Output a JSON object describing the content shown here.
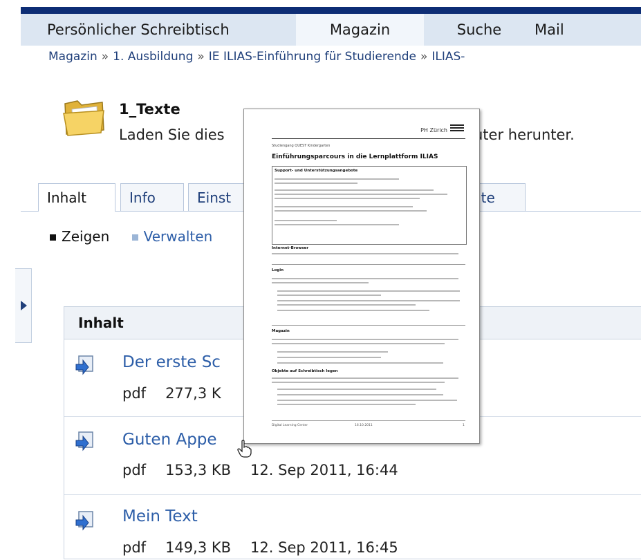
{
  "menu": {
    "items": [
      "Persönlicher Schreibtisch",
      "Magazin",
      "Suche",
      "Mail"
    ],
    "active_index": 1
  },
  "breadcrumb": {
    "items": [
      "Magazin",
      "1. Ausbildung",
      "IE ILIAS-Einführung für Studierende",
      "ILIAS-"
    ],
    "separator": "»"
  },
  "header": {
    "icon": "folder-icon",
    "title": "1_Texte",
    "description_left": "Laden Sie dies",
    "description_right": "uter herunter."
  },
  "tabs": {
    "items": [
      "Inhalt",
      "Info",
      "Einst",
      "hte"
    ],
    "active_index": 0
  },
  "subtabs": {
    "items": [
      "Zeigen",
      "Verwalten"
    ],
    "active_index": 0
  },
  "content": {
    "header": "Inhalt",
    "items": [
      {
        "title": "Der erste Sc",
        "type": "pdf",
        "size": "277,3 K",
        "date": "",
        "icon": "file-download-icon"
      },
      {
        "title": "Guten Appe",
        "type": "pdf",
        "size": "153,3 KB",
        "date": "12. Sep 2011, 16:44",
        "icon": "file-download-icon"
      },
      {
        "title": "Mein Text",
        "type": "pdf",
        "size": "149,3 KB",
        "date": "12. Sep 2011, 16:45",
        "icon": "file-download-icon"
      }
    ]
  },
  "preview": {
    "org": "PH Zürich",
    "subtitle": "Studiengang QUEST Kindergarten",
    "title": "Einführungsparcours in die Lernplattform ILIAS",
    "sections": [
      "Support- und Unterstützungsangebote",
      "Internet-Browser",
      "Login",
      "Magazin",
      "Objekte auf Schreibtisch legen"
    ],
    "footer_left": "Digital Learning Center",
    "footer_mid": "16.10.2011",
    "footer_right": "1"
  },
  "colors": {
    "topbar": "#0d2d75",
    "menu_bg": "#dce6f2",
    "link": "#2d5ea8"
  }
}
